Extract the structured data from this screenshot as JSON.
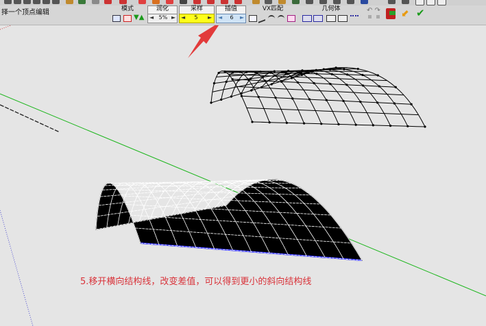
{
  "status_text": "择一个顶点编辑",
  "toolbar": {
    "mode": {
      "label": "模式"
    },
    "smooth": {
      "label": "润化",
      "value": "5%"
    },
    "sample": {
      "label": "采样",
      "value": "5"
    },
    "interp": {
      "label": "插值",
      "value": "6"
    },
    "vx_match": {
      "label": "VX匹配"
    },
    "geometry": {
      "label": "几何体"
    }
  },
  "caption": "5.移开横向结构线，改变差值，可以得到更小的斜向结构线",
  "colors": {
    "accent_red": "#d9333a",
    "axis_green": "#19b519",
    "edge_blue": "#1a1aff"
  },
  "icons": [
    "mode-icon",
    "hourglass-icon",
    "triangles-icon",
    "curve-tools-icon",
    "grid-icon",
    "exit-icon",
    "undo-icon",
    "confirm-check-icon"
  ]
}
